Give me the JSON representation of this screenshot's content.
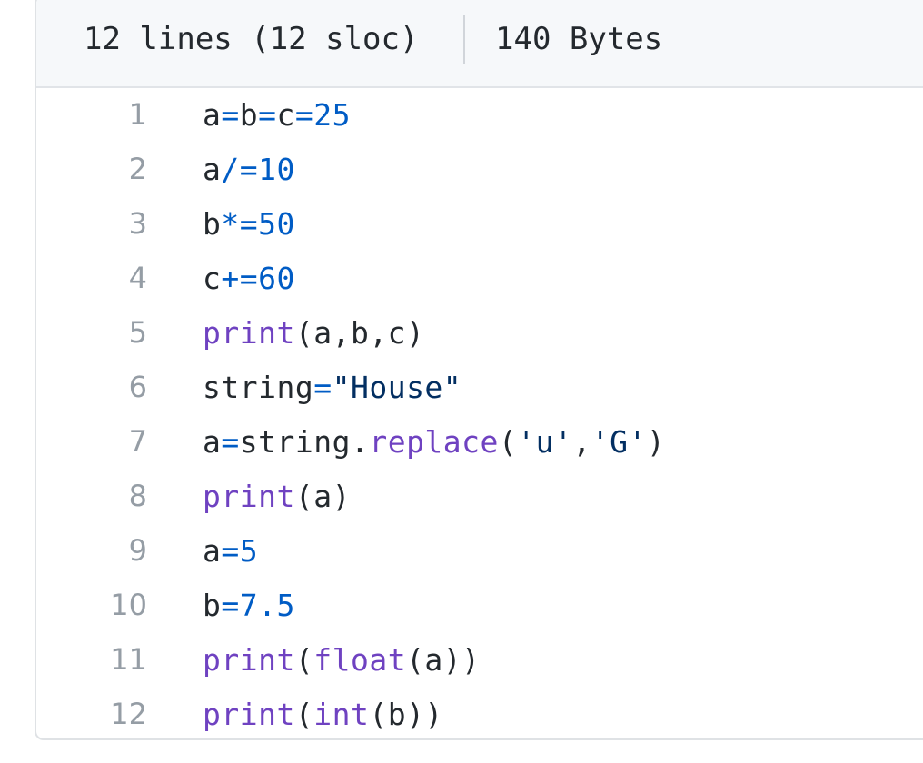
{
  "file_info": {
    "lines_text": "12 lines (12 sloc)",
    "size_text": "140 Bytes"
  },
  "colors": {
    "name": "#24292e",
    "operator": "#005cc5",
    "number": "#005cc5",
    "function": "#6f42c1",
    "string": "#032f62",
    "line_number": "#959da5"
  },
  "code_lines": [
    {
      "number": "1",
      "tokens": [
        {
          "t": "a",
          "k": "n"
        },
        {
          "t": "=",
          "k": "o"
        },
        {
          "t": "b",
          "k": "n"
        },
        {
          "t": "=",
          "k": "o"
        },
        {
          "t": "c",
          "k": "n"
        },
        {
          "t": "=",
          "k": "o"
        },
        {
          "t": "25",
          "k": "num"
        }
      ]
    },
    {
      "number": "2",
      "tokens": [
        {
          "t": "a",
          "k": "n"
        },
        {
          "t": "/=",
          "k": "o"
        },
        {
          "t": "10",
          "k": "num"
        }
      ]
    },
    {
      "number": "3",
      "tokens": [
        {
          "t": "b",
          "k": "n"
        },
        {
          "t": "*=",
          "k": "o"
        },
        {
          "t": "50",
          "k": "num"
        }
      ]
    },
    {
      "number": "4",
      "tokens": [
        {
          "t": "c",
          "k": "n"
        },
        {
          "t": "+=",
          "k": "o"
        },
        {
          "t": "60",
          "k": "num"
        }
      ]
    },
    {
      "number": "5",
      "tokens": [
        {
          "t": "print",
          "k": "f"
        },
        {
          "t": "(a,b,c)",
          "k": "n"
        }
      ]
    },
    {
      "number": "6",
      "tokens": [
        {
          "t": "string",
          "k": "n"
        },
        {
          "t": "=",
          "k": "o"
        },
        {
          "t": "\"House\"",
          "k": "s"
        }
      ]
    },
    {
      "number": "7",
      "tokens": [
        {
          "t": "a",
          "k": "n"
        },
        {
          "t": "=",
          "k": "o"
        },
        {
          "t": "string.",
          "k": "n"
        },
        {
          "t": "replace",
          "k": "f"
        },
        {
          "t": "(",
          "k": "n"
        },
        {
          "t": "'u'",
          "k": "s"
        },
        {
          "t": ",",
          "k": "n"
        },
        {
          "t": "'G'",
          "k": "s"
        },
        {
          "t": ")",
          "k": "n"
        }
      ]
    },
    {
      "number": "8",
      "tokens": [
        {
          "t": "print",
          "k": "f"
        },
        {
          "t": "(a)",
          "k": "n"
        }
      ]
    },
    {
      "number": "9",
      "tokens": [
        {
          "t": "a",
          "k": "n"
        },
        {
          "t": "=",
          "k": "o"
        },
        {
          "t": "5",
          "k": "num"
        }
      ]
    },
    {
      "number": "10",
      "tokens": [
        {
          "t": "b",
          "k": "n"
        },
        {
          "t": "=",
          "k": "o"
        },
        {
          "t": "7.5",
          "k": "num"
        }
      ]
    },
    {
      "number": "11",
      "tokens": [
        {
          "t": "print",
          "k": "f"
        },
        {
          "t": "(",
          "k": "n"
        },
        {
          "t": "float",
          "k": "f"
        },
        {
          "t": "(a))",
          "k": "n"
        }
      ]
    },
    {
      "number": "12",
      "tokens": [
        {
          "t": "print",
          "k": "f"
        },
        {
          "t": "(",
          "k": "n"
        },
        {
          "t": "int",
          "k": "f"
        },
        {
          "t": "(b))",
          "k": "n"
        }
      ]
    }
  ]
}
